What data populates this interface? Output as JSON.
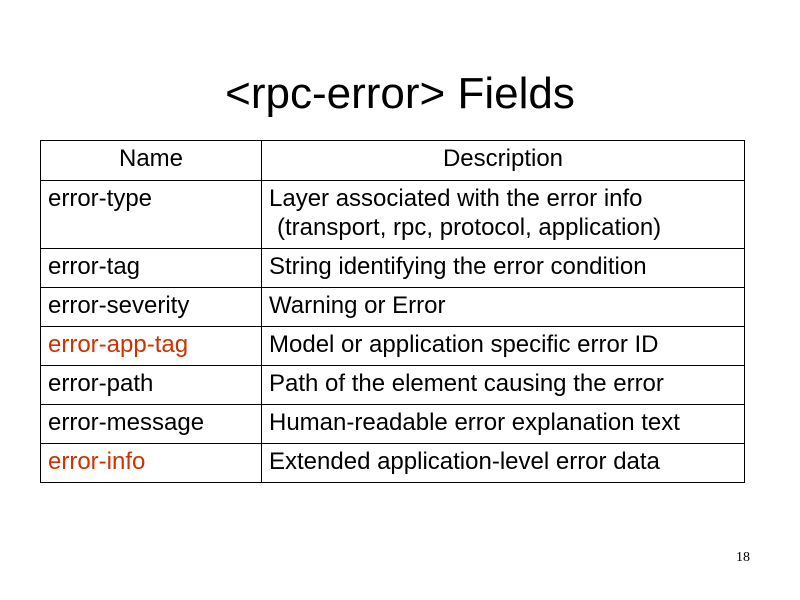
{
  "title": "<rpc-error> Fields",
  "table": {
    "headers": {
      "name": "Name",
      "description": "Description"
    },
    "rows": [
      {
        "name": "error-type",
        "description": "Layer associated with the error info",
        "description_line2": "(transport, rpc, protocol, application)",
        "highlighted": false
      },
      {
        "name": "error-tag",
        "description": "String identifying the error condition",
        "highlighted": false
      },
      {
        "name": "error-severity",
        "description": "Warning or Error",
        "highlighted": false
      },
      {
        "name": "error-app-tag",
        "description": "Model or application specific error ID",
        "highlighted": true
      },
      {
        "name": "error-path",
        "description": "Path of the element causing the error",
        "highlighted": false
      },
      {
        "name": "error-message",
        "description": "Human-readable error explanation text",
        "highlighted": false
      },
      {
        "name": "error-info",
        "description": "Extended application-level error data",
        "highlighted": true
      }
    ]
  },
  "highlight_color": "#cc3300",
  "page_number": "18"
}
